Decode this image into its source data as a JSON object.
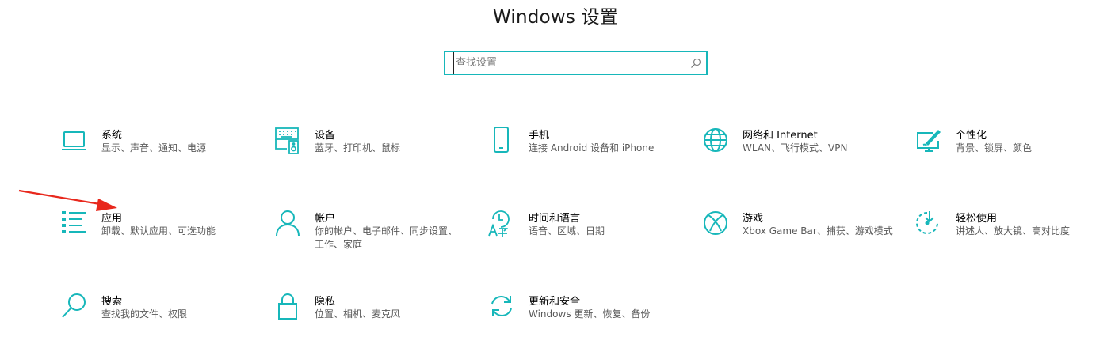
{
  "title": "Windows 设置",
  "search": {
    "placeholder": "查找设置"
  },
  "colors": {
    "accent": "#17b7ba",
    "annotation_arrow": "#e8281d"
  },
  "tiles": [
    {
      "name": "系统",
      "desc": "显示、声音、通知、电源",
      "icon": "laptop-icon"
    },
    {
      "name": "设备",
      "desc": "蓝牙、打印机、鼠标",
      "icon": "keyboard-speaker-icon"
    },
    {
      "name": "手机",
      "desc": "连接 Android 设备和 iPhone",
      "icon": "phone-icon"
    },
    {
      "name": "网络和 Internet",
      "desc": "WLAN、飞行模式、VPN",
      "icon": "globe-icon"
    },
    {
      "name": "个性化",
      "desc": "背景、锁屏、颜色",
      "icon": "paint-monitor-icon"
    },
    {
      "name": "应用",
      "desc": "卸载、默认应用、可选功能",
      "icon": "app-list-icon"
    },
    {
      "name": "帐户",
      "desc": "你的帐户、电子邮件、同步设置、工作、家庭",
      "icon": "person-icon"
    },
    {
      "name": "时间和语言",
      "desc": "语音、区域、日期",
      "icon": "time-language-icon"
    },
    {
      "name": "游戏",
      "desc": "Xbox Game Bar、捕获、游戏模式",
      "icon": "xbox-icon"
    },
    {
      "name": "轻松使用",
      "desc": "讲述人、放大镜、高对比度",
      "icon": "ease-of-access-icon"
    },
    {
      "name": "搜索",
      "desc": "查找我的文件、权限",
      "icon": "magnifier-icon"
    },
    {
      "name": "隐私",
      "desc": "位置、相机、麦克风",
      "icon": "lock-icon"
    },
    {
      "name": "更新和安全",
      "desc": "Windows 更新、恢复、备份",
      "icon": "sync-icon"
    }
  ]
}
